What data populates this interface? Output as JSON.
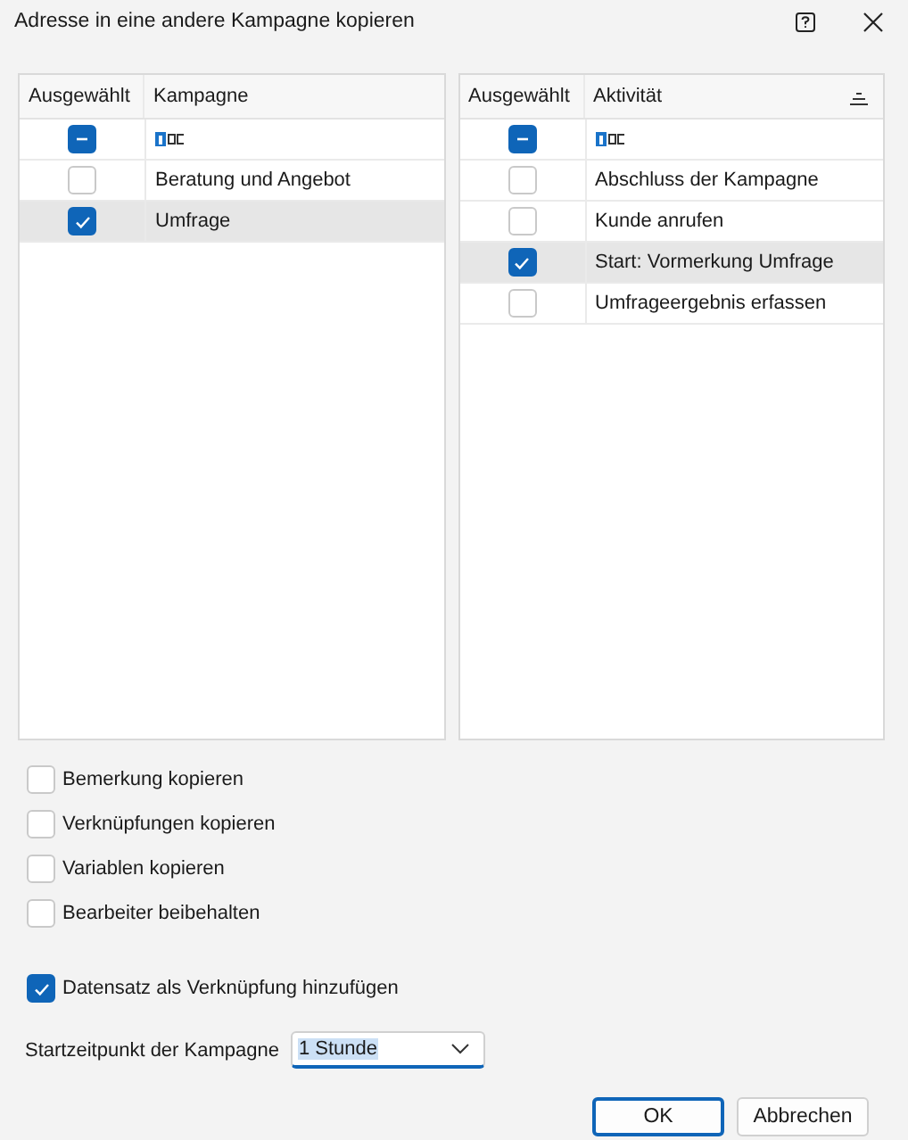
{
  "window": {
    "title": "Adresse in eine andere Kampagne kopieren"
  },
  "tables": [
    {
      "columns": [
        "Ausgewählt",
        "Kampagne"
      ],
      "sortable": false,
      "filter_row": {
        "partially_checked": true
      },
      "rows": [
        {
          "label": "Beratung und Angebot",
          "checked": false,
          "selected": false
        },
        {
          "label": "Umfrage",
          "checked": true,
          "selected": true
        }
      ]
    },
    {
      "columns": [
        "Ausgewählt",
        "Aktivität"
      ],
      "sortable": true,
      "filter_row": {
        "partially_checked": true
      },
      "rows": [
        {
          "label": "Abschluss der Kampagne",
          "checked": false,
          "selected": false
        },
        {
          "label": "Kunde anrufen",
          "checked": false,
          "selected": false
        },
        {
          "label": "Start: Vormerkung Umfrage",
          "checked": true,
          "selected": true
        },
        {
          "label": "Umfrageergebnis erfassen",
          "checked": false,
          "selected": false
        }
      ]
    }
  ],
  "options": [
    {
      "label": "Bemerkung kopieren",
      "checked": false
    },
    {
      "label": "Verknüpfungen kopieren",
      "checked": false
    },
    {
      "label": "Variablen kopieren",
      "checked": false
    },
    {
      "label": "Bearbeiter beibehalten",
      "checked": false
    }
  ],
  "link_option": {
    "label": "Datensatz als Verknüpfung hinzufügen",
    "checked": true
  },
  "start_time": {
    "label": "Startzeitpunkt der Kampagne",
    "value": "1 Stunde",
    "value_highlighted": true
  },
  "buttons": [
    {
      "label": "OK",
      "default": true
    },
    {
      "label": "Abbrechen",
      "default": false
    }
  ]
}
